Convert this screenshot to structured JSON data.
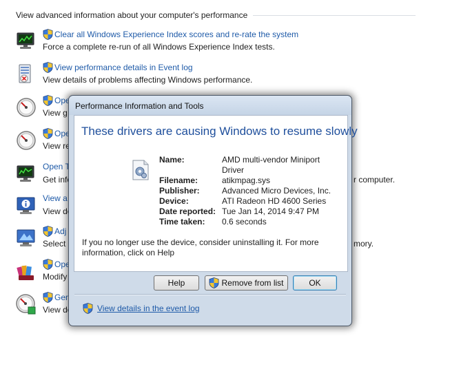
{
  "section": {
    "header": "View advanced information about your computer's performance"
  },
  "tasks": [
    {
      "link": "Clear all Windows Experience Index scores and re-rate the system",
      "desc": "Force a complete re-run of all Windows Experience Index tests.",
      "icon": "monitor-chart-icon"
    },
    {
      "link": "View performance details in Event log",
      "desc": "View details of problems affecting Windows performance.",
      "icon": "event-log-icon"
    },
    {
      "link": "Ope",
      "desc": "View g",
      "icon": "gauge-icon"
    },
    {
      "link": "Ope",
      "desc": "View re",
      "icon": "gauge-icon"
    },
    {
      "link": "Open T",
      "desc": "Get info",
      "desc_tail": "r computer.",
      "icon": "task-manager-icon"
    },
    {
      "link": "View a",
      "desc": "View de",
      "icon": "system-info-icon"
    },
    {
      "link": "Adj",
      "desc": "Select s",
      "desc_tail": "mory.",
      "icon": "visual-effects-icon"
    },
    {
      "link": "Ope",
      "desc": "Modify",
      "icon": "disk-cleanup-icon"
    },
    {
      "link": "Gen",
      "desc": "View de",
      "icon": "health-report-icon"
    }
  ],
  "dialog": {
    "title": "Performance Information and Tools",
    "heading": "These drivers are causing Windows to resume slowly",
    "driver": {
      "labels": {
        "name": "Name:",
        "filename": "Filename:",
        "publisher": "Publisher:",
        "device": "Device:",
        "date": "Date reported:",
        "time": "Time taken:"
      },
      "name": "AMD multi-vendor Miniport Driver",
      "filename": "atikmpag.sys",
      "publisher": "Advanced Micro Devices, Inc.",
      "device": "ATI Radeon HD 4600 Series",
      "date": "Tue Jan 14, 2014 9:47 PM",
      "time": "0.6 seconds"
    },
    "info": "If you no longer use the device, consider uninstalling it. For more information, click on Help",
    "buttons": {
      "help": "Help",
      "remove": "Remove from list",
      "ok": "OK"
    },
    "event_link": "View details in the event log"
  }
}
